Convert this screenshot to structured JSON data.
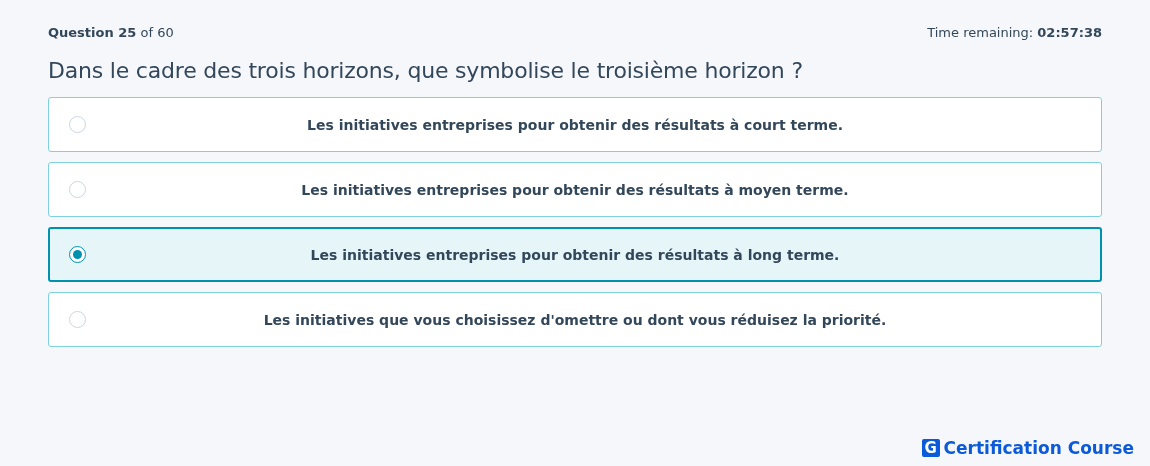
{
  "header": {
    "progress": "**Question 25** of 60",
    "timer": "Time remaining: **02:57:38**"
  },
  "question": "Dans le cadre des trois horizons, que symbolise le troisième horizon ?",
  "options": [
    {
      "label": "Les initiatives entreprises pour obtenir des résultats à court terme.",
      "selected": false
    },
    {
      "label": "Les initiatives entreprises pour obtenir des résultats à moyen terme.",
      "selected": false
    },
    {
      "label": "Les initiatives entreprises pour obtenir des résultats à long terme.",
      "selected": true
    },
    {
      "label": "Les initiatives que vous choisissez d'omettre ou dont vous réduisez la priorité.",
      "selected": false
    }
  ],
  "brand": {
    "mark": "G",
    "name": "Certification Course"
  }
}
